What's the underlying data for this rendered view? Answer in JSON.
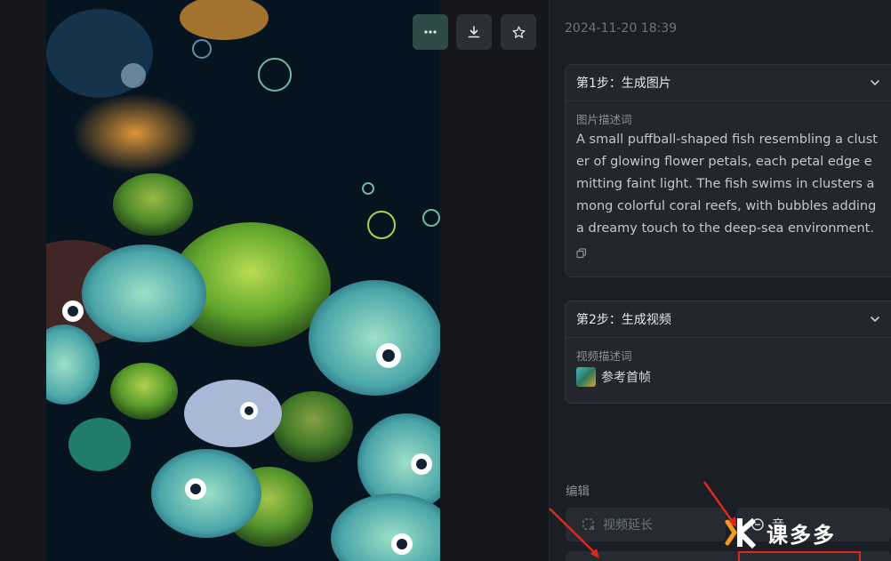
{
  "header": {
    "timestamp": "2024-11-20 18:39"
  },
  "toolbar": {
    "more_icon": "more-horizontal-icon",
    "download_icon": "download-icon",
    "favorite_icon": "star-icon"
  },
  "step1": {
    "title": "第1步：生成图片",
    "prompt_label": "图片描述词",
    "prompt_text": "A small puffball-shaped fish resembling a cluster of glowing flower petals, each petal edge emitting faint light. The fish swims in clusters among colorful coral reefs, with bubbles adding a dreamy touch to the deep-sea environment."
  },
  "step2": {
    "title": "第2步：生成视频",
    "prompt_label": "视频描述词",
    "reference_label": "参考首帧"
  },
  "edit": {
    "section_label": "编辑",
    "extend_label": "视频延长",
    "other_label": "音"
  },
  "watermark": {
    "text": "课多多"
  },
  "colors": {
    "accent_teal": "#2d4a47",
    "panel_bg": "#1b1e24",
    "card_bg": "#23262d",
    "annotation_red": "#e0271e"
  }
}
